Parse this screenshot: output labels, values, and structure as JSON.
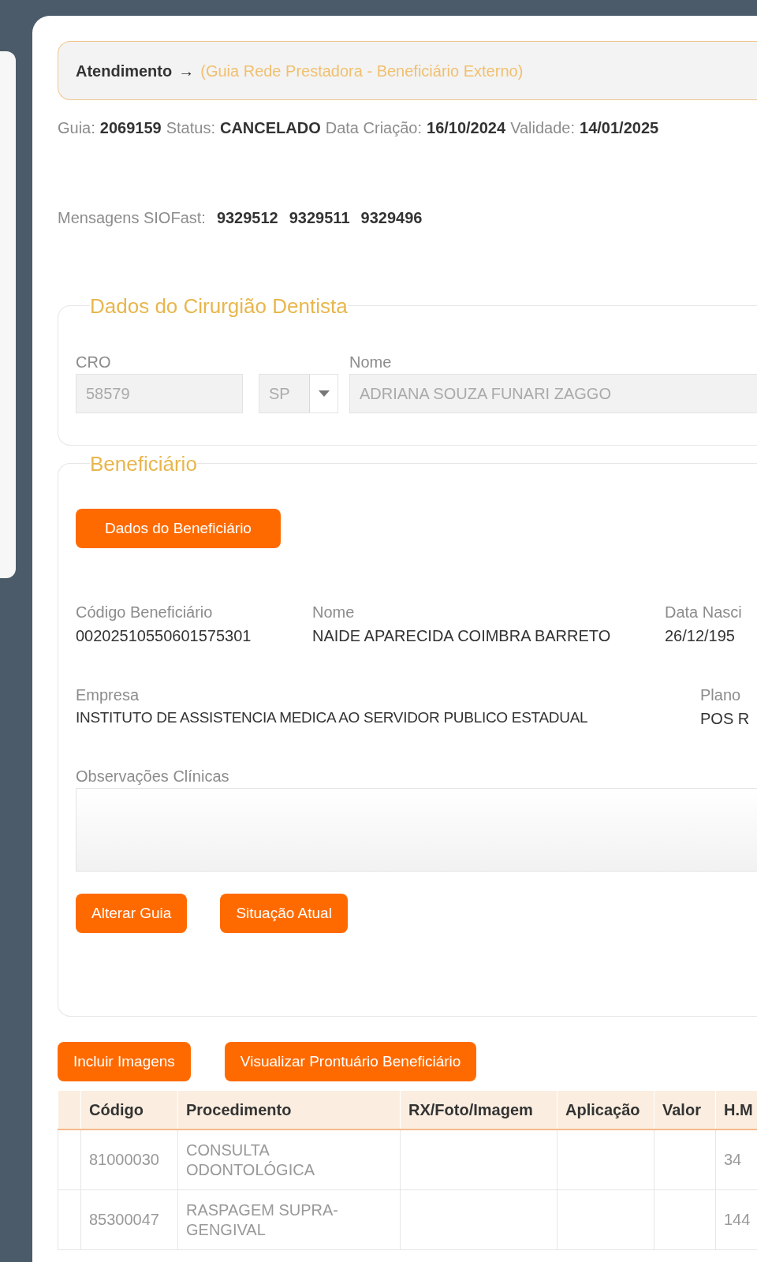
{
  "breadcrumb": {
    "title": "Atendimento",
    "arrow": "→",
    "subtitle": "(Guia Rede Prestadora - Beneficiário Externo)"
  },
  "status_line": [
    {
      "label": "Guia:",
      "value": "2069159"
    },
    {
      "label": "Status:",
      "value": "CANCELADO"
    },
    {
      "label": "Data Criação:",
      "value": "16/10/2024"
    },
    {
      "label": "Validade:",
      "value": "14/01/2025"
    }
  ],
  "messages": {
    "label": "Mensagens SIOFast:",
    "ids": [
      "9329512",
      "9329511",
      "9329496"
    ]
  },
  "dentist": {
    "legend": "Dados do Cirurgião Dentista",
    "cro_label": "CRO",
    "cro_value": "58579",
    "uf_value": "SP",
    "name_label": "Nome",
    "name_value": "ADRIANA SOUZA FUNARI ZAGGO"
  },
  "beneficiary": {
    "legend": "Beneficiário",
    "data_button": "Dados do Beneficiário",
    "fields_row1": [
      {
        "label": "Código Beneficiário",
        "value": "00202510550601575301"
      },
      {
        "label": "Nome",
        "value": "NAIDE APARECIDA COIMBRA BARRETO"
      },
      {
        "label": "Data Nasci",
        "value": "26/12/195"
      }
    ],
    "fields_row2": [
      {
        "label": "Empresa",
        "value": "INSTITUTO DE ASSISTENCIA MEDICA AO SERVIDOR PUBLICO ESTADUAL"
      },
      {
        "label": "Plano",
        "value": "POS R"
      }
    ],
    "notes_label": "Observações Clínicas",
    "buttons": [
      "Alterar Guia",
      "Situação Atual"
    ]
  },
  "actions": [
    "Incluir Imagens",
    "Visualizar Prontuário Beneficiário"
  ],
  "table": {
    "columns": [
      "Código",
      "Procedimento",
      "RX/Foto/Imagem",
      "Aplicação",
      "Valor",
      "H.M"
    ],
    "rows": [
      {
        "code": "81000030",
        "procedure": "CONSULTA ODONTOLÓGICA",
        "hm": "34"
      },
      {
        "code": "85300047",
        "procedure": "RASPAGEM SUPRA-GENGIVAL",
        "hm": "144"
      }
    ]
  }
}
